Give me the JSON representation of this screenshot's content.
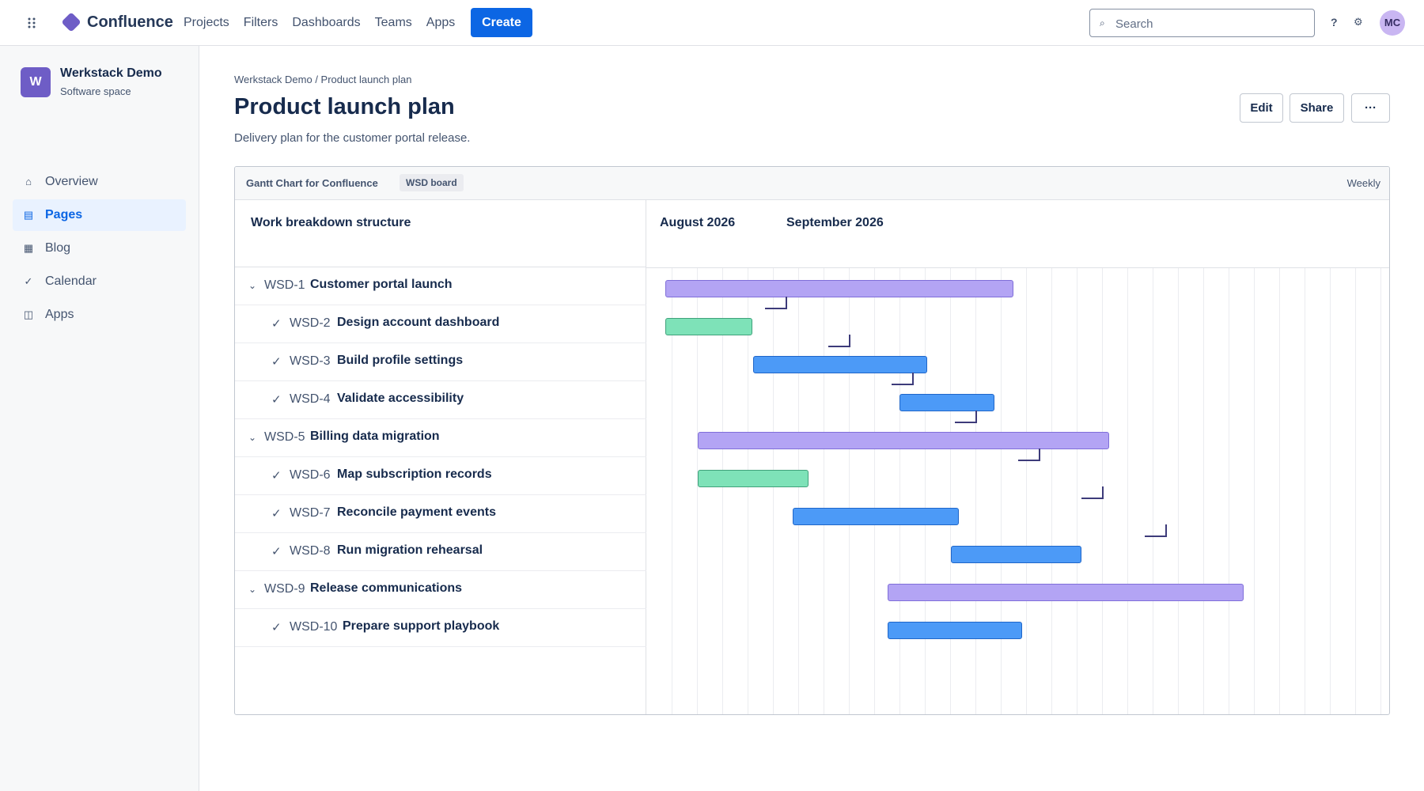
{
  "app": {
    "brand": "Confluence",
    "nav": [
      "Projects",
      "Filters",
      "Dashboards",
      "Teams",
      "Apps"
    ],
    "create_label": "Create",
    "search_placeholder": "Search",
    "help_glyph": "?",
    "settings_glyph": "⚙",
    "user_initials": "MC",
    "colors": {
      "primary": "#0c66e4",
      "logo": "#6e5dc6"
    }
  },
  "sidebar": {
    "space_initial": "W",
    "space_name": "Werkstack Demo",
    "space_type": "Software space",
    "items": [
      {
        "label": "Overview",
        "icon": "home-icon",
        "glyph": "⌂",
        "active": false
      },
      {
        "label": "Pages",
        "icon": "pages-icon",
        "glyph": "▤",
        "active": true
      },
      {
        "label": "Blog",
        "icon": "blog-icon",
        "glyph": "▦",
        "active": false
      },
      {
        "label": "Calendar",
        "icon": "calendar-icon",
        "glyph": "✓",
        "active": false
      },
      {
        "label": "Apps",
        "icon": "apps-icon",
        "glyph": "◫",
        "active": false
      }
    ]
  },
  "page": {
    "breadcrumb": "Werkstack Demo / Product launch plan",
    "title": "Product launch plan",
    "description": "Delivery plan for the customer portal release.",
    "actions": {
      "edit": "Edit",
      "share": "Share",
      "more": "···"
    }
  },
  "gantt": {
    "macro_title": "Gantt Chart for Confluence",
    "badge": "WSD board",
    "scale": "Weekly",
    "wbs_header": "Work breakdown structure",
    "months": [
      "August 2026",
      "September 2026"
    ],
    "expand_glyph": "⌄",
    "done_glyph": "✓",
    "rows": [
      {
        "key": "WSD-1",
        "name": "Customer portal launch",
        "level": 0,
        "type": "epic"
      },
      {
        "key": "WSD-2",
        "name": "Design account dashboard",
        "level": 1,
        "type": "done"
      },
      {
        "key": "WSD-3",
        "name": "Build profile settings",
        "level": 1,
        "type": "task"
      },
      {
        "key": "WSD-4",
        "name": "Validate accessibility",
        "level": 1,
        "type": "task"
      },
      {
        "key": "WSD-5",
        "name": "Billing data migration",
        "level": 0,
        "type": "epic"
      },
      {
        "key": "WSD-6",
        "name": "Map subscription records",
        "level": 1,
        "type": "done"
      },
      {
        "key": "WSD-7",
        "name": "Reconcile payment events",
        "level": 1,
        "type": "task"
      },
      {
        "key": "WSD-8",
        "name": "Run migration rehearsal",
        "level": 1,
        "type": "task"
      },
      {
        "key": "WSD-9",
        "name": "Release communications",
        "level": 0,
        "type": "epic"
      },
      {
        "key": "WSD-10",
        "name": "Prepare support playbook",
        "level": 1,
        "type": "task"
      }
    ],
    "colors": {
      "epic": "#b3a4f4",
      "done": "#7ee2b8",
      "task": "#4c9af7"
    }
  }
}
